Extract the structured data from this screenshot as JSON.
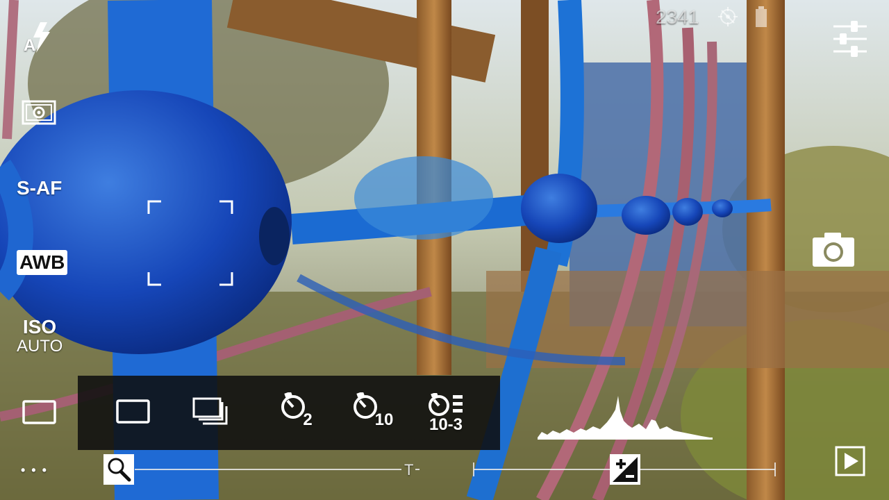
{
  "status": {
    "shots_remaining": "2341"
  },
  "left_bar": {
    "flash_icon": "flash-auto-icon",
    "flash_label": "A",
    "metering_icon": "metering-icon",
    "focus_label": "S-AF",
    "wb_label": "AWB",
    "iso_label": "ISO",
    "iso_value": "AUTO",
    "drive_icon": "single-shot-icon",
    "more_label": "• • •"
  },
  "drive_menu": {
    "items": [
      {
        "icon": "single-shot-icon",
        "label": ""
      },
      {
        "icon": "continuous-shot-icon",
        "label": ""
      },
      {
        "icon": "self-timer-icon",
        "label": "2"
      },
      {
        "icon": "self-timer-icon",
        "label": "10"
      },
      {
        "icon": "self-timer-burst-icon",
        "label": "10-3"
      }
    ]
  },
  "zoom": {
    "icon": "magnifier-icon",
    "tele_label": "T",
    "level": 0.0
  },
  "exposure": {
    "icon": "exposure-compensation-icon",
    "value": 0
  },
  "right_bar": {
    "settings_icon": "sliders-icon",
    "shutter_icon": "camera-icon",
    "playback_icon": "play-icon"
  },
  "histogram": {
    "icon": "histogram"
  }
}
